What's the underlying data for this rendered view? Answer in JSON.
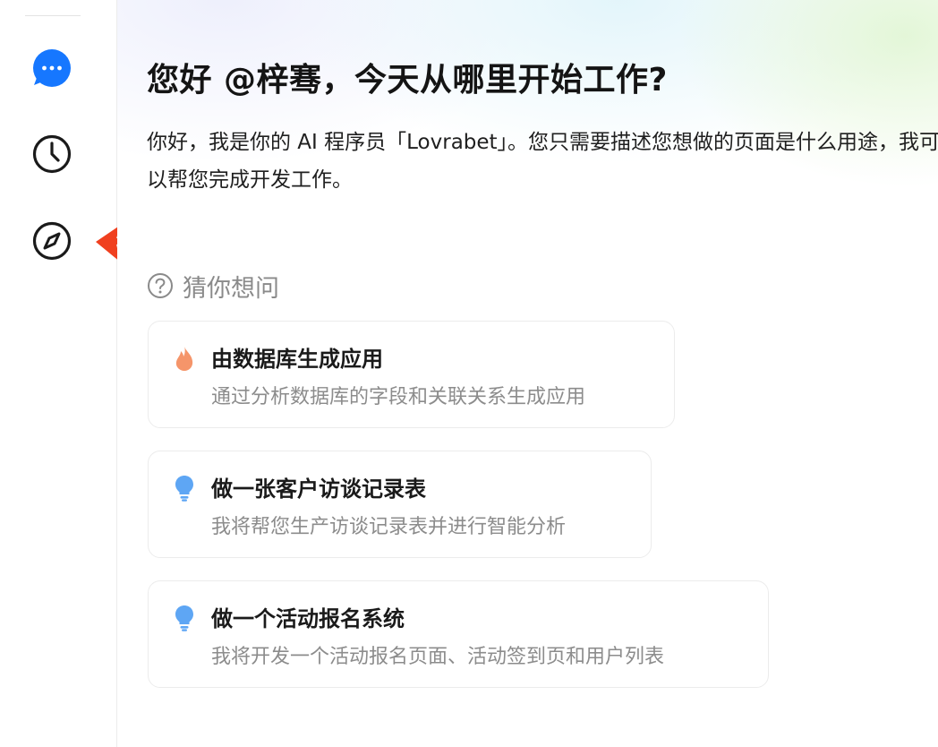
{
  "sidebar": {
    "items": [
      {
        "name": "chat",
        "icon": "chat-bubble-icon",
        "color": "#1677ff"
      },
      {
        "name": "history",
        "icon": "clock-icon",
        "color": "#1a1a1a"
      },
      {
        "name": "explore",
        "icon": "compass-icon",
        "color": "#1a1a1a"
      }
    ]
  },
  "annotation": {
    "icon": "red-arrow-icon",
    "color": "#f0401f"
  },
  "main": {
    "greeting": "您好 @梓骞，今天从哪里开始工作?",
    "intro": "你好，我是你的 AI 程序员「Lovrabet」。您只需要描述您想做的页面是什么用途，我可以帮您完成开发工作。",
    "suggestions": {
      "heading": "猜你想问",
      "heading_icon": "question-circle-icon",
      "items": [
        {
          "title": "由数据库生成应用",
          "desc": "通过分析数据库的字段和关联关系生成应用",
          "icon": "fire-icon",
          "color": "#f5956a"
        },
        {
          "title": "做一张客户访谈记录表",
          "desc": "我将帮您生产访谈记录表并进行智能分析",
          "icon": "lightbulb-icon",
          "color": "#5ea6f4"
        },
        {
          "title": "做一个活动报名系统",
          "desc": "我将开发一个活动报名页面、活动签到页和用户列表",
          "icon": "lightbulb-icon",
          "color": "#5ea6f4"
        }
      ]
    }
  }
}
